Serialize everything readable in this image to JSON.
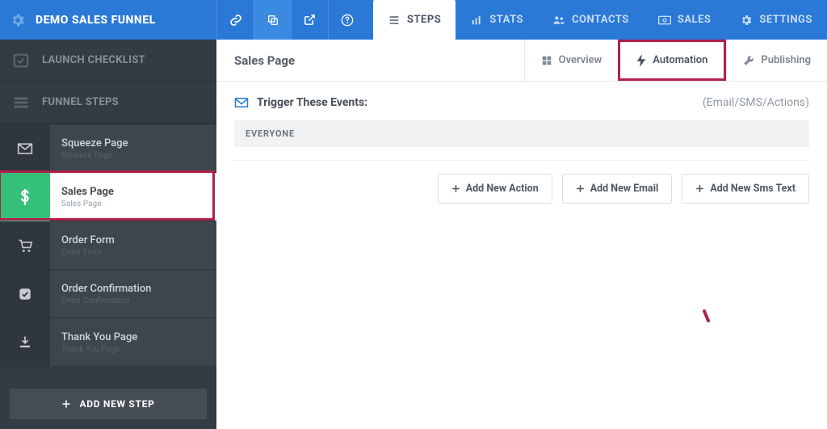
{
  "header": {
    "title": "DEMO SALES FUNNEL",
    "tabs": {
      "steps": "STEPS",
      "stats": "STATS",
      "contacts": "CONTACTS",
      "sales": "SALES",
      "settings": "SETTINGS"
    }
  },
  "sidebar": {
    "launch_label": "LAUNCH CHECKLIST",
    "funnel_label": "FUNNEL STEPS",
    "add_step_label": "ADD NEW STEP",
    "steps": [
      {
        "title": "Squeeze Page",
        "sub": "Squeeze Page"
      },
      {
        "title": "Sales Page",
        "sub": "Sales Page"
      },
      {
        "title": "Order Form",
        "sub": "Order Form"
      },
      {
        "title": "Order Confirmation",
        "sub": "Order Confirmation"
      },
      {
        "title": "Thank You Page",
        "sub": "Thank You Page"
      }
    ]
  },
  "page": {
    "title": "Sales Page",
    "subtabs": {
      "overview": "Overview",
      "automation": "Automation",
      "publishing": "Publishing"
    },
    "trigger_title": "Trigger These Events:",
    "trigger_note": "(Email/SMS/Actions)",
    "group_label": "EVERYONE",
    "buttons": {
      "action": "Add New Action",
      "email": "Add New Email",
      "sms": "Add New Sms Text"
    }
  }
}
